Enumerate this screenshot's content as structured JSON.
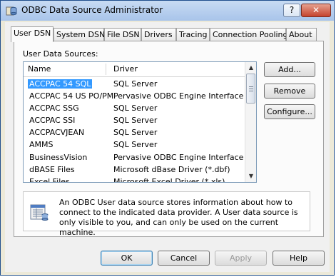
{
  "window": {
    "title": "ODBC Data Source Administrator"
  },
  "titlebar": {
    "help_glyph": "?",
    "close_glyph": "✕"
  },
  "tabs": [
    {
      "label": "User DSN"
    },
    {
      "label": "System DSN"
    },
    {
      "label": "File DSN"
    },
    {
      "label": "Drivers"
    },
    {
      "label": "Tracing"
    },
    {
      "label": "Connection Pooling"
    },
    {
      "label": "About"
    }
  ],
  "panel": {
    "list_label": "User Data Sources:"
  },
  "list": {
    "headers": {
      "name": "Name",
      "driver": "Driver"
    },
    "rows": [
      {
        "name": "ACCPAC 54 SQL",
        "driver": "SQL Server"
      },
      {
        "name": "ACCPAC 54 US PO/PM",
        "driver": "Pervasive ODBC Engine Interface"
      },
      {
        "name": "ACCPAC SSG",
        "driver": "SQL Server"
      },
      {
        "name": "ACCPAC SSI",
        "driver": "SQL Server"
      },
      {
        "name": "ACCPACVJEAN",
        "driver": "SQL Server"
      },
      {
        "name": "AMMS",
        "driver": "SQL Server"
      },
      {
        "name": "BusinessVision",
        "driver": "Pervasive ODBC Engine Interface"
      },
      {
        "name": "dBASE Files",
        "driver": "Microsoft dBase Driver (*.dbf)"
      },
      {
        "name": "Excel Files",
        "driver": "Microsoft Excel Driver (*.xls)"
      }
    ],
    "selected_row": "ACCPAC 54 SQL"
  },
  "side_buttons": {
    "add": "Add...",
    "remove": "Remove",
    "configure": "Configure..."
  },
  "info": {
    "icon": "data-source-icon",
    "text": "An ODBC User data source stores information about how to connect to the indicated data provider.  A User data source is only visible to you, and can only be used on the current machine."
  },
  "footer": {
    "ok": "OK",
    "cancel": "Cancel",
    "apply": "Apply",
    "help": "Help"
  },
  "colors": {
    "selection": "#3399ff",
    "window_border": "#1f4e8c"
  }
}
